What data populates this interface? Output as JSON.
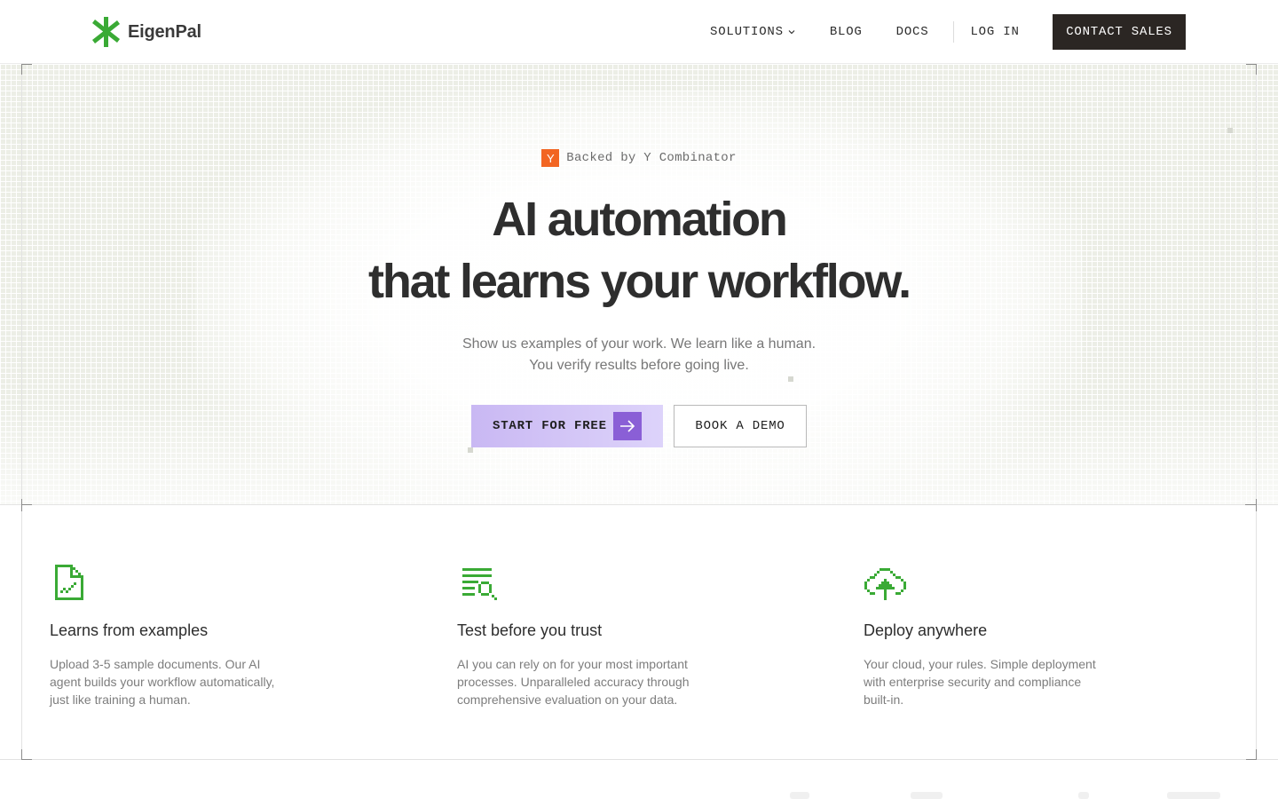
{
  "nav": {
    "brand": "EigenPal",
    "links": [
      "SOLUTIONS",
      "BLOG",
      "DOCS"
    ],
    "login": "LOG IN",
    "contact": "CONTACT SALES"
  },
  "hero": {
    "badge_letter": "Y",
    "badge_text": "Backed by Y Combinator",
    "headline_line1": "AI automation",
    "headline_line2": "that learns your workflow.",
    "sub_line1": "Show us examples of your work. We learn like a human.",
    "sub_line2": "You verify results before going live.",
    "cta_primary": "START FOR FREE",
    "cta_secondary": "BOOK A DEMO"
  },
  "features": [
    {
      "icon": "document-chart-icon",
      "title": "Learns from examples",
      "desc": "Upload 3-5 sample documents. Our AI agent builds your workflow automatically, just like training a human."
    },
    {
      "icon": "list-search-icon",
      "title": "Test before you trust",
      "desc": "AI you can rely on for your most important processes. Unparalleled accuracy through comprehensive evaluation on your data."
    },
    {
      "icon": "cloud-upload-icon",
      "title": "Deploy anywhere",
      "desc": "Your cloud, your rules. Simple deployment with enterprise security and compliance built-in."
    }
  ],
  "colors": {
    "brand_green": "#3aaa35",
    "contact_bg": "#2b2623",
    "primary_gradient_start": "#c9b8f3",
    "primary_gradient_end": "#ddd3fa",
    "arrow_box": "#8a5fd6",
    "yc_orange": "#f26522"
  }
}
